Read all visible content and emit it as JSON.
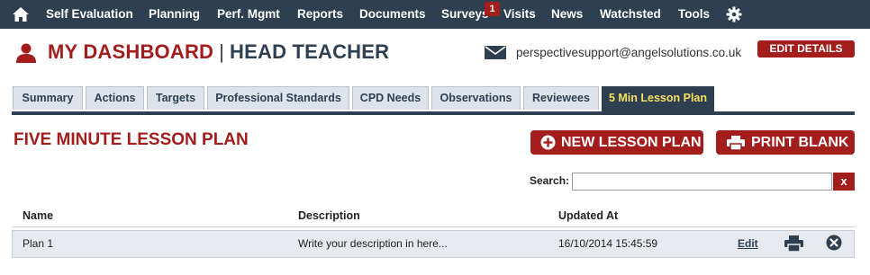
{
  "nav": {
    "items": [
      "Self Evaluation",
      "Planning",
      "Perf. Mgmt",
      "Reports",
      "Documents",
      "Surveys",
      "Visits",
      "News",
      "Watchsted",
      "Tools"
    ],
    "surveys_badge": "1"
  },
  "header": {
    "title_main": "MY DASHBOARD",
    "separator": "|",
    "title_role": "HEAD TEACHER",
    "email": "perspectivesupport@angelsolutions.co.uk",
    "edit_details_label": "EDIT DETAILS"
  },
  "tabs": [
    {
      "label": "Summary"
    },
    {
      "label": "Actions"
    },
    {
      "label": "Targets"
    },
    {
      "label": "Professional Standards"
    },
    {
      "label": "CPD Needs"
    },
    {
      "label": "Observations"
    },
    {
      "label": "Reviewees"
    },
    {
      "label": "5 Min Lesson Plan"
    }
  ],
  "section": {
    "title": "FIVE MINUTE LESSON PLAN",
    "new_button_label": "NEW LESSON PLAN",
    "print_button_label": "PRINT BLANK"
  },
  "search": {
    "label": "Search:",
    "value": "",
    "clear_label": "x"
  },
  "table": {
    "columns": [
      "Name",
      "Description",
      "Updated At"
    ],
    "rows": [
      {
        "name": "Plan 1",
        "description": "Write your description in here...",
        "updated_at": "16/10/2014 15:45:59",
        "edit_label": "Edit"
      }
    ]
  },
  "colors": {
    "nav_bg": "#2e3f52",
    "brand_red": "#a31d1d",
    "active_tab_text": "#f6e05e",
    "row_bg": "#e6eaee"
  }
}
